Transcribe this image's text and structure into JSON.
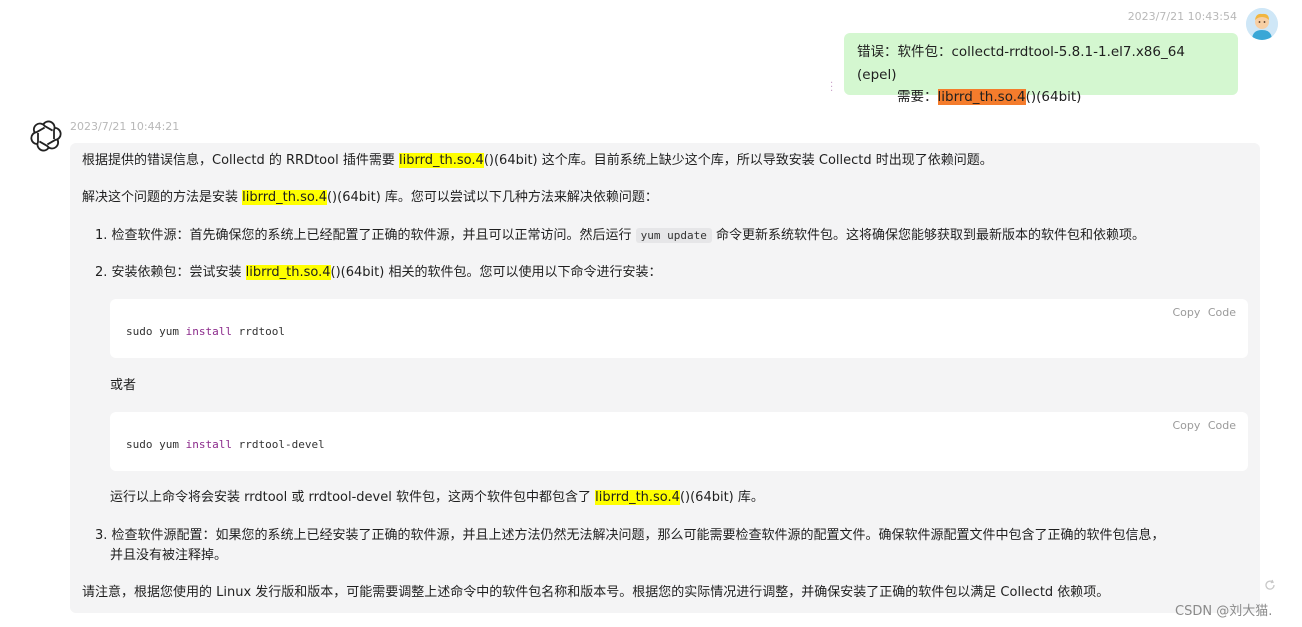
{
  "user_message": {
    "time": "2023/7/21 10:43:54",
    "line1": "错误：软件包：collectd-rrdtool-5.8.1-1.el7.x86_64 (epel)",
    "line2_prefix": "需要：",
    "line2_highlight": "librrd_th.so.4",
    "line2_suffix": "()(64bit)"
  },
  "bot_message": {
    "time": "2023/7/21 10:44:21",
    "p1_a": "根据提供的错误信息，Collectd 的 RRDtool 插件需要 ",
    "p1_hl": "librrd_th.so.4",
    "p1_b": "()(64bit) 这个库。目前系统上缺少这个库，所以导致安装 Collectd 时出现了依赖问题。",
    "p2_a": "解决这个问题的方法是安装 ",
    "p2_hl": "librrd_th.so.4",
    "p2_b": "()(64bit) 库。您可以尝试以下几种方法来解决依赖问题：",
    "item1_a": "1. 检查软件源：首先确保您的系统上已经配置了正确的软件源，并且可以正常访问。然后运行 ",
    "item1_code": "yum update",
    "item1_b": " 命令更新系统软件包。这将确保您能够获取到最新版本的软件包和依赖项。",
    "item2_a": "2. 安装依赖包：尝试安装 ",
    "item2_hl": "librrd_th.so.4",
    "item2_b": "()(64bit) 相关的软件包。您可以使用以下命令进行安装：",
    "code1": {
      "copy": "Copy Code",
      "pre": "sudo yum ",
      "kw": "install",
      "post": " rrdtool"
    },
    "or_text": "或者",
    "code2": {
      "copy": "Copy Code",
      "pre": "sudo yum ",
      "kw": "install",
      "post": " rrdtool-devel"
    },
    "after_a": "运行以上命令将会安装 rrdtool 或 rrdtool-devel 软件包，这两个软件包中都包含了 ",
    "after_hl": "librrd_th.so.4",
    "after_b": "()(64bit) 库。",
    "item3_line1": "3. 检查软件源配置：如果您的系统上已经安装了正确的软件源，并且上述方法仍然无法解决问题，那么可能需要检查软件源的配置文件。确保软件源配置文件中包含了正确的软件包信息，",
    "item3_line2": "并且没有被注释掉。",
    "note": "请注意，根据您使用的 Linux 发行版和版本，可能需要调整上述命令中的软件包名称和版本号。根据您的实际情况进行调整，并确保安装了正确的软件包以满足 Collectd 依赖项。"
  },
  "watermark": "CSDN @刘大猫."
}
